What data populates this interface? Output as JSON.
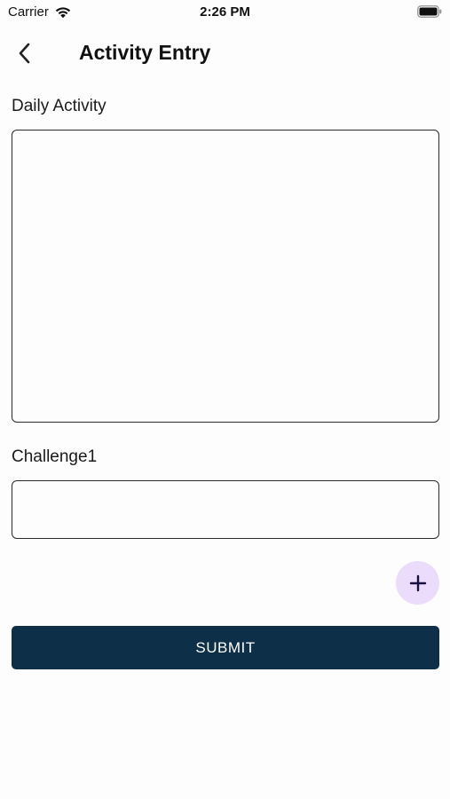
{
  "status_bar": {
    "carrier": "Carrier",
    "time": "2:26 PM",
    "icons": [
      "wifi-icon",
      "battery-icon"
    ]
  },
  "header": {
    "title": "Activity Entry",
    "back_icon": "chevron-left-icon"
  },
  "form": {
    "daily_activity": {
      "label": "Daily Activity",
      "value": ""
    },
    "challenge": {
      "label": "Challenge1",
      "value": ""
    },
    "add_icon": "plus-icon",
    "submit_label": "SUBMIT"
  },
  "colors": {
    "submit_background": "#0d2f47",
    "add_button_background": "#ebdcfb",
    "add_icon_color": "#1b1140"
  }
}
